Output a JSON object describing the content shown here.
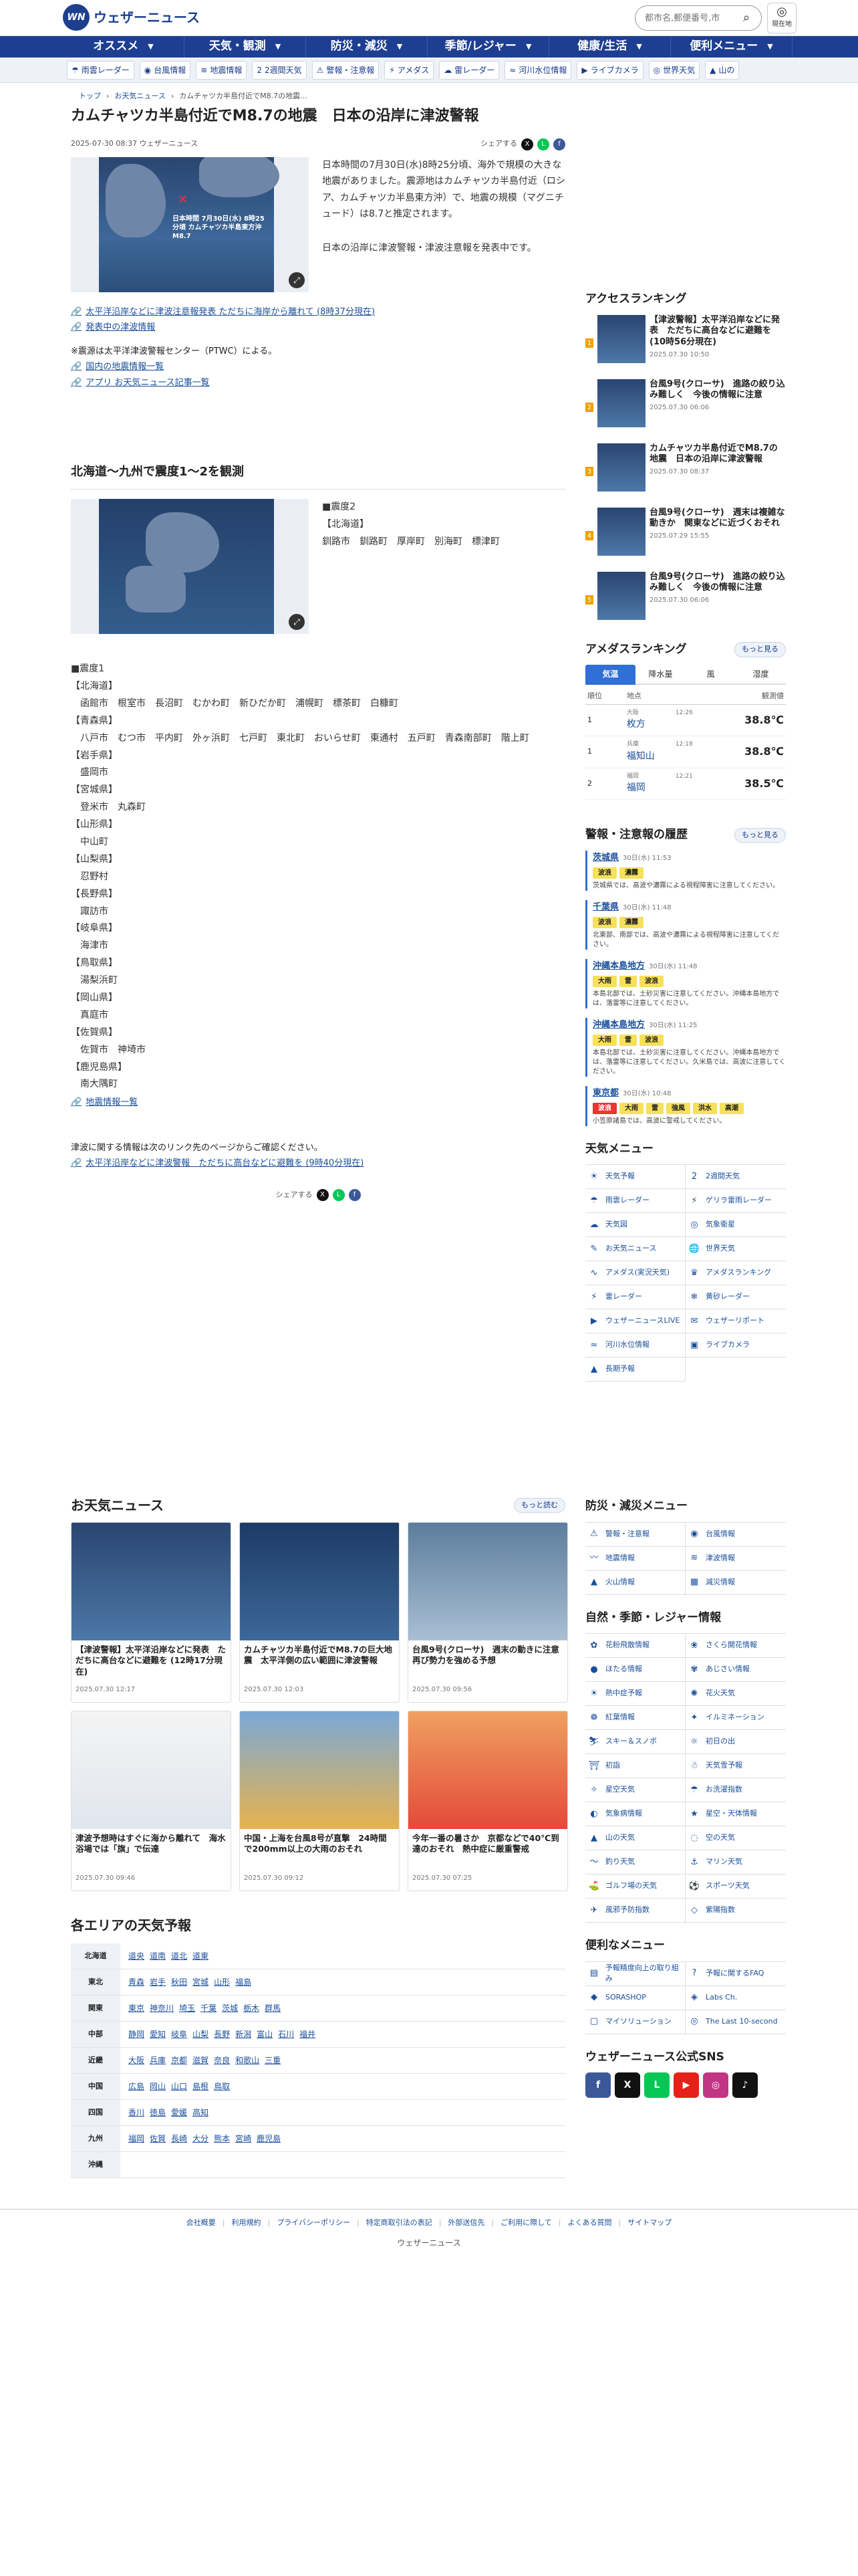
{
  "header": {
    "logo_text": "ウェザーニュース",
    "search_placeholder": "都市名,郵便番号,市",
    "location_label": "現在地"
  },
  "gnav": [
    "オススメ",
    "天気・観測",
    "防災・減災",
    "季節/レジャー",
    "健康/生活",
    "便利メニュー"
  ],
  "subnav": [
    {
      "icon": "☂",
      "label": "雨雲レーダー"
    },
    {
      "icon": "◉",
      "label": "台風情報"
    },
    {
      "icon": "≋",
      "label": "地震情報"
    },
    {
      "icon": "2",
      "label": "2週間天気"
    },
    {
      "icon": "⚠",
      "label": "警報・注意報"
    },
    {
      "icon": "⚡",
      "label": "アメダス"
    },
    {
      "icon": "☁",
      "label": "雷レーダー"
    },
    {
      "icon": "≈",
      "label": "河川水位情報"
    },
    {
      "icon": "▶",
      "label": "ライブカメラ"
    },
    {
      "icon": "◎",
      "label": "世界天気"
    },
    {
      "icon": "▲",
      "label": "山の"
    }
  ],
  "breadcrumb": [
    "トップ",
    "お天気ニュース",
    "カムチャツカ半島付近でM8.7の地震..."
  ],
  "article": {
    "title": "カムチャツカ半島付近でM8.7の地震　日本の沿岸に津波警報",
    "date": "2025-07-30 08:37 ウェザーニュース",
    "share_label": "シェアする",
    "map_caption": "日本時間 7月30日(水) 8時25分頃 カムチャツカ半島東方沖 M8.7",
    "body1": "日本時間の7月30日(水)8時25分頃、海外で規模の大きな地震がありました。震源地はカムチャツカ半島付近（ロシア、カムチャツカ半島東方沖）で、地震の規模（マグニチュード）は8.7と推定されます。",
    "body2": "日本の沿岸に津波警報・津波注意報を発表中です。",
    "links1": [
      "太平洋沿岸などに津波注意報発表 ただちに海岸から離れて (8時37分現在)",
      "発表中の津波情報"
    ],
    "source_note": "※震源は太平洋津波警報センター（PTWC）による。",
    "links2": [
      "国内の地震情報一覧",
      "アプリ お天気ニュース記事一覧"
    ],
    "sec2_title": "北海道〜九州で震度1〜2を観測",
    "int2_head": "■震度2",
    "int2": [
      "【北海道】",
      "釧路市　釧路町　厚岸町　別海町　標津町"
    ],
    "int1_head": "■震度1",
    "int1": [
      "【北海道】",
      "函館市　根室市　長沼町　むかわ町　新ひだか町　浦幌町　標茶町　白糠町",
      "【青森県】",
      "八戸市　むつ市　平内町　外ヶ浜町　七戸町　東北町　おいらせ町　東通村　五戸町　青森南部町　階上町",
      "【岩手県】",
      "盛岡市",
      "【宮城県】",
      "登米市　丸森町",
      "【山形県】",
      "中山町",
      "【山梨県】",
      "忍野村",
      "【長野県】",
      "諏訪市",
      "【岐阜県】",
      "海津市",
      "【鳥取県】",
      "湯梨浜町",
      "【岡山県】",
      "真庭市",
      "【佐賀県】",
      "佐賀市　神埼市",
      "【鹿児島県】",
      "南大隅町"
    ],
    "link3": "地震情報一覧",
    "note2": "津波に関する情報は次のリンク先のページからご確認ください。",
    "link4": "太平洋沿岸などに津波警報　ただちに高台などに避難を (9時40分現在)"
  },
  "sidebar": {
    "ranking_title": "アクセスランキング",
    "ranking": [
      {
        "rank": "1",
        "title": "【津波警報】太平洋沿岸などに発表　ただちに高台などに避難を (10時56分現在)",
        "date": "2025.07.30 10:50"
      },
      {
        "rank": "2",
        "title": "台風9号(クローサ)　進路の絞り込み難しく　今後の情報に注意",
        "date": "2025.07.30 06:06"
      },
      {
        "rank": "3",
        "title": "カムチャツカ半島付近でM8.7の地震　日本の沿岸に津波警報",
        "date": "2025.07.30 08:37"
      },
      {
        "rank": "4",
        "title": "台風9号(クローサ)　週末は複雑な動きか　関東などに近づくおそれ",
        "date": "2025.07.29 15:55"
      },
      {
        "rank": "5",
        "title": "台風9号(クローサ)　進路の絞り込み難しく　今後の情報に注意",
        "date": "2025.07.30 06:06"
      }
    ],
    "amedas_title": "アメダスランキング",
    "more_label": "もっと見る",
    "amedas_tabs": [
      "気温",
      "降水量",
      "風",
      "湿度"
    ],
    "amedas_head": [
      "順位",
      "地点",
      "観測値"
    ],
    "amedas": [
      {
        "rank": "1",
        "pref": "大阪",
        "place": "枚方",
        "time": "12:26",
        "value": "38.8℃"
      },
      {
        "rank": "1",
        "pref": "兵庫",
        "place": "福知山",
        "time": "12:18",
        "value": "38.8℃"
      },
      {
        "rank": "2",
        "pref": "福岡",
        "place": "福岡",
        "time": "12:21",
        "value": "38.5℃"
      }
    ],
    "warn_title": "警報・注意報の履歴",
    "warns": [
      {
        "name": "茨城県",
        "time": "30日(水) 11:53",
        "tags": [
          "波浪",
          "濃霧"
        ],
        "reds": [],
        "desc": "茨城県では、高波や濃霧による視程障害に注意してください。"
      },
      {
        "name": "千葉県",
        "time": "30日(水) 11:48",
        "tags": [
          "波浪",
          "濃霧"
        ],
        "reds": [],
        "desc": "北東部、南部では、高波や濃霧による視程障害に注意してください。"
      },
      {
        "name": "沖縄本島地方",
        "time": "30日(水) 11:48",
        "tags": [
          "大雨",
          "雷",
          "波浪"
        ],
        "reds": [],
        "desc": "本島北部では、土砂災害に注意してください。沖縄本島地方では、落雷等に注意してください。"
      },
      {
        "name": "沖縄本島地方",
        "time": "30日(水) 11:25",
        "tags": [
          "大雨",
          "雷",
          "波浪"
        ],
        "reds": [],
        "desc": "本島北部では、土砂災害に注意してください。沖縄本島地方では、落雷等に注意してください。久米島では、高波に注意してください。"
      },
      {
        "name": "東京都",
        "time": "30日(水) 10:48",
        "tags": [
          "大雨",
          "雷",
          "強風",
          "洪水",
          "高潮"
        ],
        "reds": [
          "波浪"
        ],
        "desc": "小笠原諸島では、高波に警戒してください。"
      }
    ],
    "weather_menu_title": "天気メニュー",
    "weather_menu": [
      [
        "☀",
        "天気予報"
      ],
      [
        "2",
        "2週間天気"
      ],
      [
        "☂",
        "雨雲レーダー"
      ],
      [
        "⚡",
        "ゲリラ雷雨レーダー"
      ],
      [
        "☁",
        "天気図"
      ],
      [
        "◎",
        "気象衛星"
      ],
      [
        "✎",
        "お天気ニュース"
      ],
      [
        "🌐",
        "世界天気"
      ],
      [
        "∿",
        "アメダス(実況天気)"
      ],
      [
        "♛",
        "アメダスランキング"
      ],
      [
        "⚡",
        "雷レーダー"
      ],
      [
        "❄",
        "黄砂レーダー"
      ],
      [
        "▶",
        "ウェザーニュースLIVE"
      ],
      [
        "✉",
        "ウェザーリポート"
      ],
      [
        "≈",
        "河川水位情報"
      ],
      [
        "▣",
        "ライブカメラ"
      ],
      [
        "▲",
        "長期予報"
      ]
    ],
    "disaster_title": "防災・減災メニュー",
    "disaster_menu": [
      [
        "⚠",
        "警報・注意報"
      ],
      [
        "◉",
        "台風情報"
      ],
      [
        "〰",
        "地震情報"
      ],
      [
        "≋",
        "津波情報"
      ],
      [
        "▲",
        "火山情報"
      ],
      [
        "▦",
        "減災情報"
      ]
    ],
    "season_title": "自然・季節・レジャー情報",
    "season_menu": [
      [
        "✿",
        "花粉飛散情報"
      ],
      [
        "❀",
        "さくら開花情報"
      ],
      [
        "●",
        "ほたる情報"
      ],
      [
        "✾",
        "あじさい情報"
      ],
      [
        "☀",
        "熱中症予報"
      ],
      [
        "✺",
        "花火天気"
      ],
      [
        "❁",
        "紅葉情報"
      ],
      [
        "✦",
        "イルミネーション"
      ],
      [
        "⛷",
        "スキー＆スノボ"
      ],
      [
        "☼",
        "初日の出"
      ],
      [
        "⛩",
        "初詣"
      ],
      [
        "☃",
        "天気雪予報"
      ],
      [
        "✧",
        "星空天気"
      ],
      [
        "☂",
        "お洗濯指数"
      ],
      [
        "◐",
        "気象病情報"
      ],
      [
        "★",
        "星空・天体情報"
      ],
      [
        "▲",
        "山の天気"
      ],
      [
        "◌",
        "空の天気"
      ],
      [
        "〜",
        "釣り天気"
      ],
      [
        "⚓",
        "マリン天気"
      ],
      [
        "⛳",
        "ゴルフ場の天気"
      ],
      [
        "⚽",
        "スポーツ天気"
      ],
      [
        "✈",
        "風邪予防指数"
      ],
      [
        "◇",
        "紫陽指数"
      ]
    ],
    "useful_title": "便利なメニュー",
    "useful_menu": [
      [
        "▤",
        "予報精度向上の取り組み"
      ],
      [
        "?",
        "予報に関するFAQ"
      ],
      [
        "◆",
        "SORASHOP"
      ],
      [
        "◈",
        "Labs Ch."
      ],
      [
        "▢",
        "マイソリューション"
      ],
      [
        "◎",
        "The Last 10-second"
      ]
    ],
    "sns_title": "ウェザーニュース公式SNS",
    "sns": [
      [
        "f",
        "#3b5998"
      ],
      [
        "X",
        "#111"
      ],
      [
        "L",
        "#06c755"
      ],
      [
        "▶",
        "#e62117"
      ],
      [
        "◎",
        "#c13584"
      ],
      [
        "♪",
        "#111"
      ]
    ]
  },
  "news": {
    "title": "お天気ニュース",
    "more": "もっと読む",
    "items": [
      {
        "title": "【津波警報】太平洋沿岸などに発表　ただちに高台などに避難を (12時17分現在)",
        "date": "2025.07.30 12:17"
      },
      {
        "title": "カムチャツカ半島付近でM8.7の巨大地震　太平洋側の広い範囲に津波警報",
        "date": "2025.07.30 12:03"
      },
      {
        "title": "台風9号(クローサ)　週末の動きに注意　再び勢力を強める予想",
        "date": "2025.07.30 09:56"
      },
      {
        "title": "津波予想時はすぐに海から離れて　海水浴場では「旗」で伝達",
        "date": "2025.07.30 09:46"
      },
      {
        "title": "中国・上海を台風8号が直撃　24時間で200mm以上の大雨のおそれ",
        "date": "2025.07.30 09:12"
      },
      {
        "title": "今年一番の暑さか　京都などで40℃到達のおそれ　熱中症に厳重警戒",
        "date": "2025.07.30 07:25"
      }
    ]
  },
  "areas": {
    "title": "各エリアの天気予報",
    "rows": [
      {
        "region": "北海道",
        "prefs": [
          "道央",
          "道南",
          "道北",
          "道東"
        ]
      },
      {
        "region": "東北",
        "prefs": [
          "青森",
          "岩手",
          "秋田",
          "宮城",
          "山形",
          "福島"
        ]
      },
      {
        "region": "関東",
        "prefs": [
          "東京",
          "神奈川",
          "埼玉",
          "千葉",
          "茨城",
          "栃木",
          "群馬"
        ]
      },
      {
        "region": "中部",
        "prefs": [
          "静岡",
          "愛知",
          "岐阜",
          "山梨",
          "長野",
          "新潟",
          "富山",
          "石川",
          "福井"
        ]
      },
      {
        "region": "近畿",
        "prefs": [
          "大阪",
          "兵庫",
          "京都",
          "滋賀",
          "奈良",
          "和歌山",
          "三重"
        ]
      },
      {
        "region": "中国",
        "prefs": [
          "広島",
          "岡山",
          "山口",
          "島根",
          "鳥取"
        ]
      },
      {
        "region": "四国",
        "prefs": [
          "香川",
          "徳島",
          "愛媛",
          "高知"
        ]
      },
      {
        "region": "九州",
        "prefs": [
          "福岡",
          "佐賀",
          "長崎",
          "大分",
          "熊本",
          "宮崎",
          "鹿児島"
        ]
      },
      {
        "region": "沖縄",
        "prefs": []
      }
    ]
  },
  "footer": {
    "links": [
      "会社概要",
      "利用規約",
      "プライバシーポリシー",
      "特定商取引法の表記",
      "外部送信先",
      "ご利用に際して",
      "よくある質問",
      "サイトマップ"
    ],
    "copyright": "ウェザーニュース"
  },
  "colors": {
    "brand": "#1e3e92",
    "link": "#1a4f9c",
    "rank": "#f0a000",
    "warn_yellow": "#f7e05a",
    "warn_red": "#e33"
  }
}
